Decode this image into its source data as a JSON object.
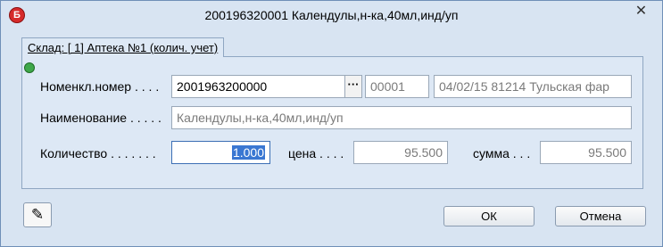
{
  "window": {
    "title": "200196320001  Календулы,н-ка,40мл,инд/уп",
    "app_icon": "Б"
  },
  "tab": {
    "label": "Склад: [      1] Аптека №1 (колич. учет)"
  },
  "fields": {
    "nomenclature_label": "Номенкл.номер . . . .",
    "nomenclature_value": "2001963200000",
    "nomenclature_code": "00001",
    "nomenclature_info": "04/02/15 81214 Тульская фар",
    "name_label": "Наименование . . . . .",
    "name_value": "Календулы,н-ка,40мл,инд/уп",
    "quantity_label": "Количество . . . . . . .",
    "quantity_value": "1.000",
    "price_label": "цена . . . .",
    "price_value": "95.500",
    "sum_label": "сумма . . .",
    "sum_value": "95.500"
  },
  "buttons": {
    "ok": "ОК",
    "cancel": "Отмена",
    "dots": "···"
  },
  "icons": {
    "close": "close-icon",
    "help": "help-icon",
    "status": "status-dot-icon"
  },
  "colors": {
    "status_dot": "#3fa84a",
    "selection": "#3a77d2"
  }
}
